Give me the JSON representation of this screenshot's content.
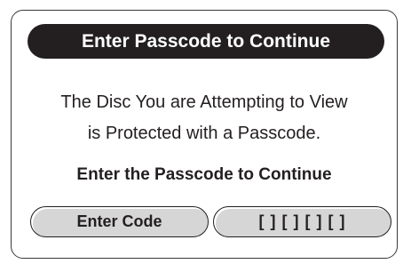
{
  "dialog": {
    "title": "Enter Passcode to Continue",
    "message_line1": "The Disc You are Attempting to View",
    "message_line2": "is Protected with a Passcode.",
    "instruction": "Enter the Passcode to Continue",
    "enter_code_label": "Enter Code",
    "code_field_value": "[ ] [ ] [ ] [ ]"
  },
  "colors": {
    "title_bar": "#231f20",
    "button_fill": "#d6d6d6",
    "border": "#3a3a3a"
  }
}
